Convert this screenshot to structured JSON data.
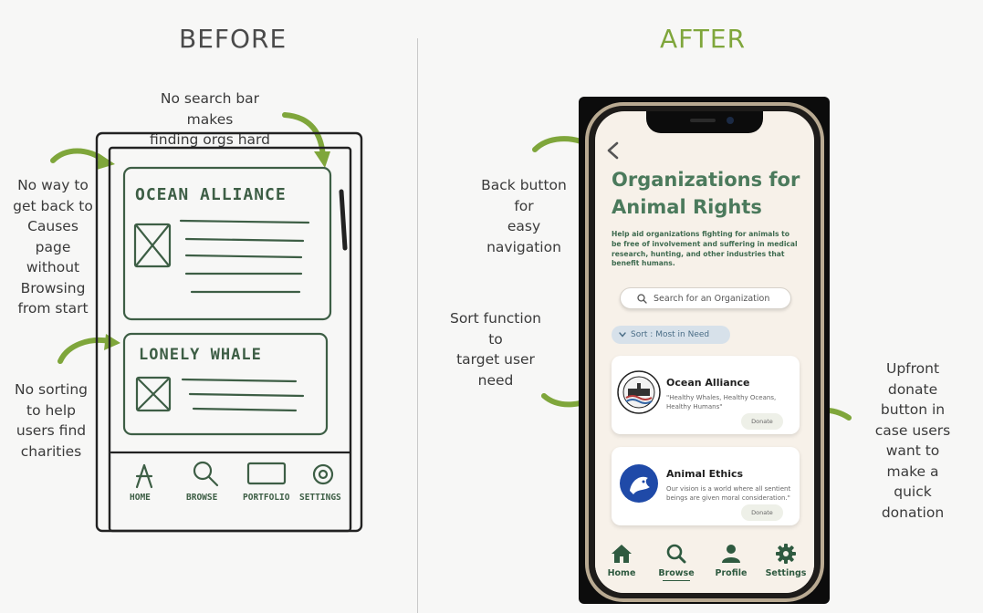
{
  "headings": {
    "before": "BEFORE",
    "after": "AFTER"
  },
  "notes": {
    "search": "No search bar makes\nfinding orgs hard",
    "back": "No way to\nget back to\nCauses\npage\nwithout\nBrowsing\nfrom start",
    "sorting": "No sorting\nto help\nusers find\ncharities",
    "back_button": "Back button\nfor\neasy\nnavigation",
    "sort_function": "Sort function\nto\ntarget user\nneed",
    "upfront_donate": "Upfront\ndonate\nbutton in\ncase users\nwant to\nmake a\nquick\ndonation"
  },
  "sketch": {
    "card1_title": "OCEAN ALLIANCE",
    "card2_title": "LONELY WHALE",
    "nav": [
      "HOME",
      "BROWSE",
      "PORTFOLIO",
      "SETTINGS"
    ]
  },
  "app": {
    "title": "Organizations for Animal Rights",
    "description": "Help aid organizations fighting for animals to be free of involvement and suffering in medical research, hunting, and other industries that benefit humans.",
    "search_placeholder": "Search for an Organization",
    "sort_label": "Sort : Most in Need",
    "orgs": [
      {
        "name": "Ocean Alliance",
        "quote": "\"Healthy Whales, Healthy Oceans, Healthy Humans\"",
        "donate": "Donate"
      },
      {
        "name": "Animal Ethics",
        "quote": "Our vision is a world where all sentient beings are given moral consideration.\"",
        "donate": "Donate"
      }
    ],
    "tabs": [
      "Home",
      "Browse",
      "Profile",
      "Settings"
    ]
  },
  "colors": {
    "after_heading": "#7fa63b",
    "arrow": "#7fa63b",
    "sketch": "#3d5e45",
    "app_green": "#2f5a40"
  }
}
